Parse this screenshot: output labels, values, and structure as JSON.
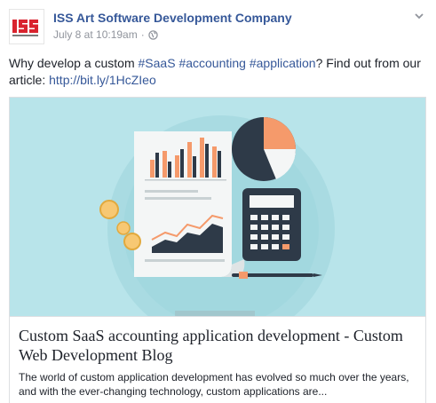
{
  "post": {
    "page_name": "ISS Art Software Development Company",
    "timestamp": "July 8 at 10:19am",
    "separator": "·",
    "privacy_icon": "globe-icon",
    "menu_icon": "chevron-down-icon",
    "avatar_logo_text": "ISS"
  },
  "message": {
    "prefix": "Why develop a custom ",
    "hashtags": [
      "#SaaS",
      "#accounting",
      "#application"
    ],
    "middle": "? Find out from our article: ",
    "link": "http://bit.ly/1HcZIeo"
  },
  "link_card": {
    "image_alt_icon": "accounting-illustration",
    "title": "Custom SaaS accounting application development - Custom Web Development Blog",
    "description": "The world of custom application development has evolved so much over the years, and with the ever-changing technology, custom applications are..."
  },
  "colors": {
    "link_blue": "#365899",
    "meta_gray": "#90949c",
    "illustration_bg": "#b8e4ea",
    "accent_orange": "#f59a6b",
    "dark_navy": "#2e3a48"
  }
}
